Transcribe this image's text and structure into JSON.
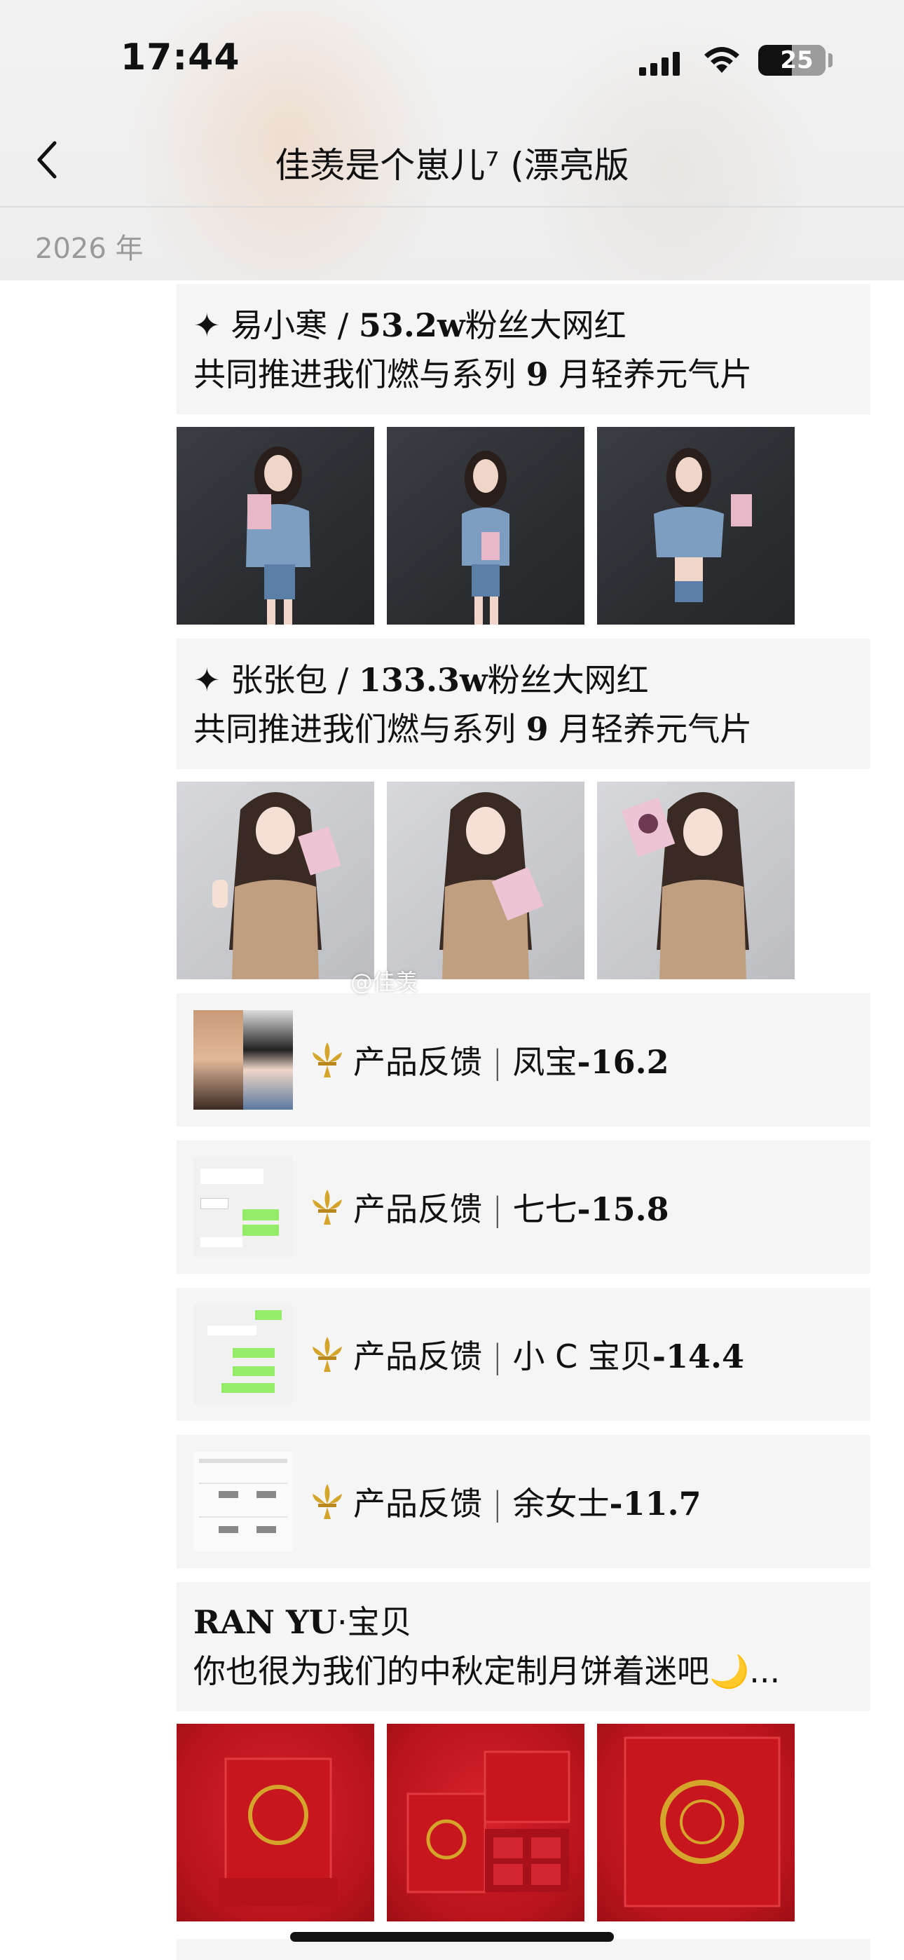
{
  "status_bar": {
    "time": "17:44",
    "battery": "25"
  },
  "nav": {
    "title": "佳羡是个崽儿⁷ (漂亮版"
  },
  "year_label": "2026 年",
  "posts": [
    {
      "star": "✦",
      "name": "易小寒 / ",
      "fans": "53.2w",
      "suffix": "粉丝大网红",
      "line2_a": "共同推进我们燃与系列 ",
      "line2_num": "9",
      "line2_b": " 月轻养元气片"
    },
    {
      "star": "✦",
      "name": "张张包 / ",
      "fans": "133.3w",
      "suffix": "粉丝大网红",
      "line2_a": "共同推进我们燃与系列 ",
      "line2_num": "9",
      "line2_b": " 月轻养元气片"
    }
  ],
  "watermark": "@佳羡",
  "feedback": [
    {
      "label": "产品反馈",
      "who": "凤宝",
      "value": "-16.2"
    },
    {
      "label": "产品反馈",
      "who": "七七",
      "value": "-15.8"
    },
    {
      "label": "产品反馈",
      "who": "小 C 宝贝",
      "value": "-14.4"
    },
    {
      "label": "产品反馈",
      "who": "余女士",
      "value": "-11.7"
    }
  ],
  "ranyu": {
    "name": "RAN YU",
    "dot": "·",
    "suffix": "宝贝",
    "line2": "你也很为我们的中秋定制月饼着迷吧",
    "emoji": "🌙",
    "ellipsis": "..."
  },
  "colors": {
    "card_bg": "#f5f5f5",
    "gold": "#d4a52a",
    "red_box": "#c8161e"
  }
}
